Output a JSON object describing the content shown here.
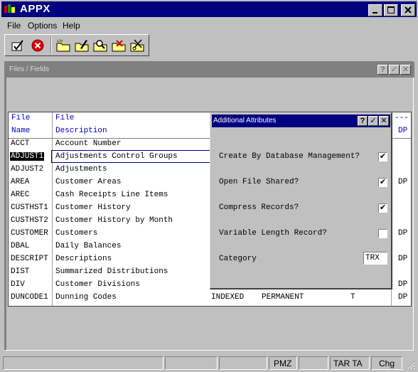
{
  "window": {
    "title": "APPX"
  },
  "menu": {
    "file": "File",
    "options": "Options",
    "help": "Help"
  },
  "toolbar_icons": [
    "ok-check-icon",
    "cancel-icon",
    "new-folder-icon",
    "edit-folder-icon",
    "search-folder-icon",
    "delete-folder-icon",
    "cut-folder-icon"
  ],
  "child": {
    "title": "Files / Fields",
    "help_btn": "?",
    "ok_btn": "✓",
    "close_btn": "✕"
  },
  "grid": {
    "headers": {
      "file_line1": "File",
      "file_line2": "Name",
      "desc_line1": "File",
      "desc_line2": "Description",
      "right_line1": "---",
      "right_line2": "DP"
    },
    "rows": [
      {
        "name": "ACCT",
        "desc": "Account Number",
        "right": ""
      },
      {
        "name": "ADJUST1",
        "desc": "Adjustments Control Groups",
        "right": ""
      },
      {
        "name": "ADJUST2",
        "desc": "Adjustments",
        "right": ""
      },
      {
        "name": "AREA",
        "desc": "Customer Areas",
        "right": "DP"
      },
      {
        "name": "AREC",
        "desc": "Cash Receipts Line Items",
        "right": ""
      },
      {
        "name": "CUSTHST1",
        "desc": "Customer History",
        "right": ""
      },
      {
        "name": "CUSTHST2",
        "desc": "Customer History by Month",
        "right": ""
      },
      {
        "name": "CUSTOMER",
        "desc": "Customers",
        "right": "DP"
      },
      {
        "name": "DBAL",
        "desc": "Daily Balances",
        "right": ""
      },
      {
        "name": "DESCRIPT",
        "desc": "Descriptions",
        "right": "DP"
      },
      {
        "name": "DIST",
        "desc": "Summarized Distributions",
        "right": ""
      },
      {
        "name": "DIV",
        "desc": "Customer Divisions",
        "right": "DP"
      },
      {
        "name": "DUNCODE1",
        "desc": "Dunning Codes",
        "right": "DP",
        "org": "INDEXED",
        "type": "PERMANENT",
        "flag": "T"
      }
    ]
  },
  "dialog": {
    "title": "Additional Attributes",
    "help_btn": "?",
    "ok_btn": "✓",
    "close_btn": "✕",
    "create_by_dbm": {
      "label": "Create By Database Management?",
      "checked": "✔"
    },
    "open_shared": {
      "label": "Open File Shared?",
      "checked": "✔"
    },
    "compress": {
      "label": "Compress Records?",
      "checked": "✔"
    },
    "variable_length": {
      "label": "Variable Length Record?",
      "checked": ""
    },
    "category": {
      "label": "Category",
      "value": "TRX"
    }
  },
  "status": {
    "p1": "",
    "p2": "",
    "p3": "",
    "p4": "PMZ",
    "p5": "",
    "p6": "TAR TA",
    "p7": "Chg"
  },
  "colors": {
    "titlebar": "#000080",
    "header_text": "#0000c8",
    "face": "#c0c0c0"
  }
}
